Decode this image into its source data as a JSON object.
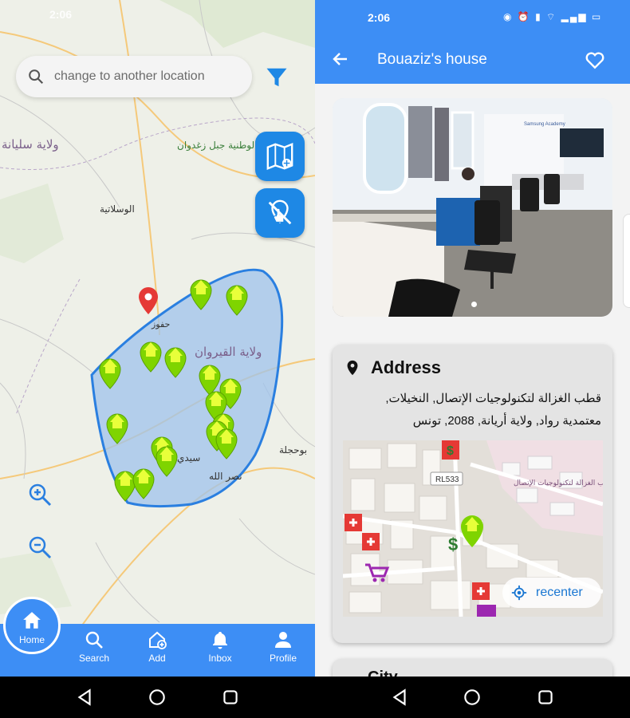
{
  "left": {
    "status_time": "2:06",
    "search_placeholder": "change to another location",
    "map_labels": {
      "region1": "ولاية سليانة",
      "park": "الحديقة الوطنية جبل زغدوان",
      "city1": "الوسلاتية",
      "region2": "ولاية القيروان",
      "city2": "سيدي سعد",
      "city3": "نصر الله",
      "city4": "بوحجلة",
      "town": "حفوز"
    },
    "tabs": [
      {
        "label": "Home"
      },
      {
        "label": "Search"
      },
      {
        "label": "Add"
      },
      {
        "label": "Inbox"
      },
      {
        "label": "Profile"
      }
    ]
  },
  "right": {
    "status_time": "2:06",
    "title": "Bouaziz's house",
    "address_heading": "Address",
    "address_line1": "قطب الغزالة لتكنولوجيات الإتصال, النخيلات,",
    "address_line2": "معتمدية رواد, ولاية أريانة, 2088, تونس",
    "map_road_label": "RL533",
    "map_place_label": "قطب الغزالة لتكنولوجيات الإتصال",
    "recenter_label": "recenter",
    "next_card_label": "City",
    "photo_sign": "Samsung Academy"
  },
  "colors": {
    "brand_blue": "#3d8ef5",
    "zone_fill": "#9fc3ec",
    "zone_stroke": "#2a7fe0",
    "marker_green": "#7fd400",
    "marker_yellow": "#e8ff3a",
    "pin_red": "#e53935"
  }
}
